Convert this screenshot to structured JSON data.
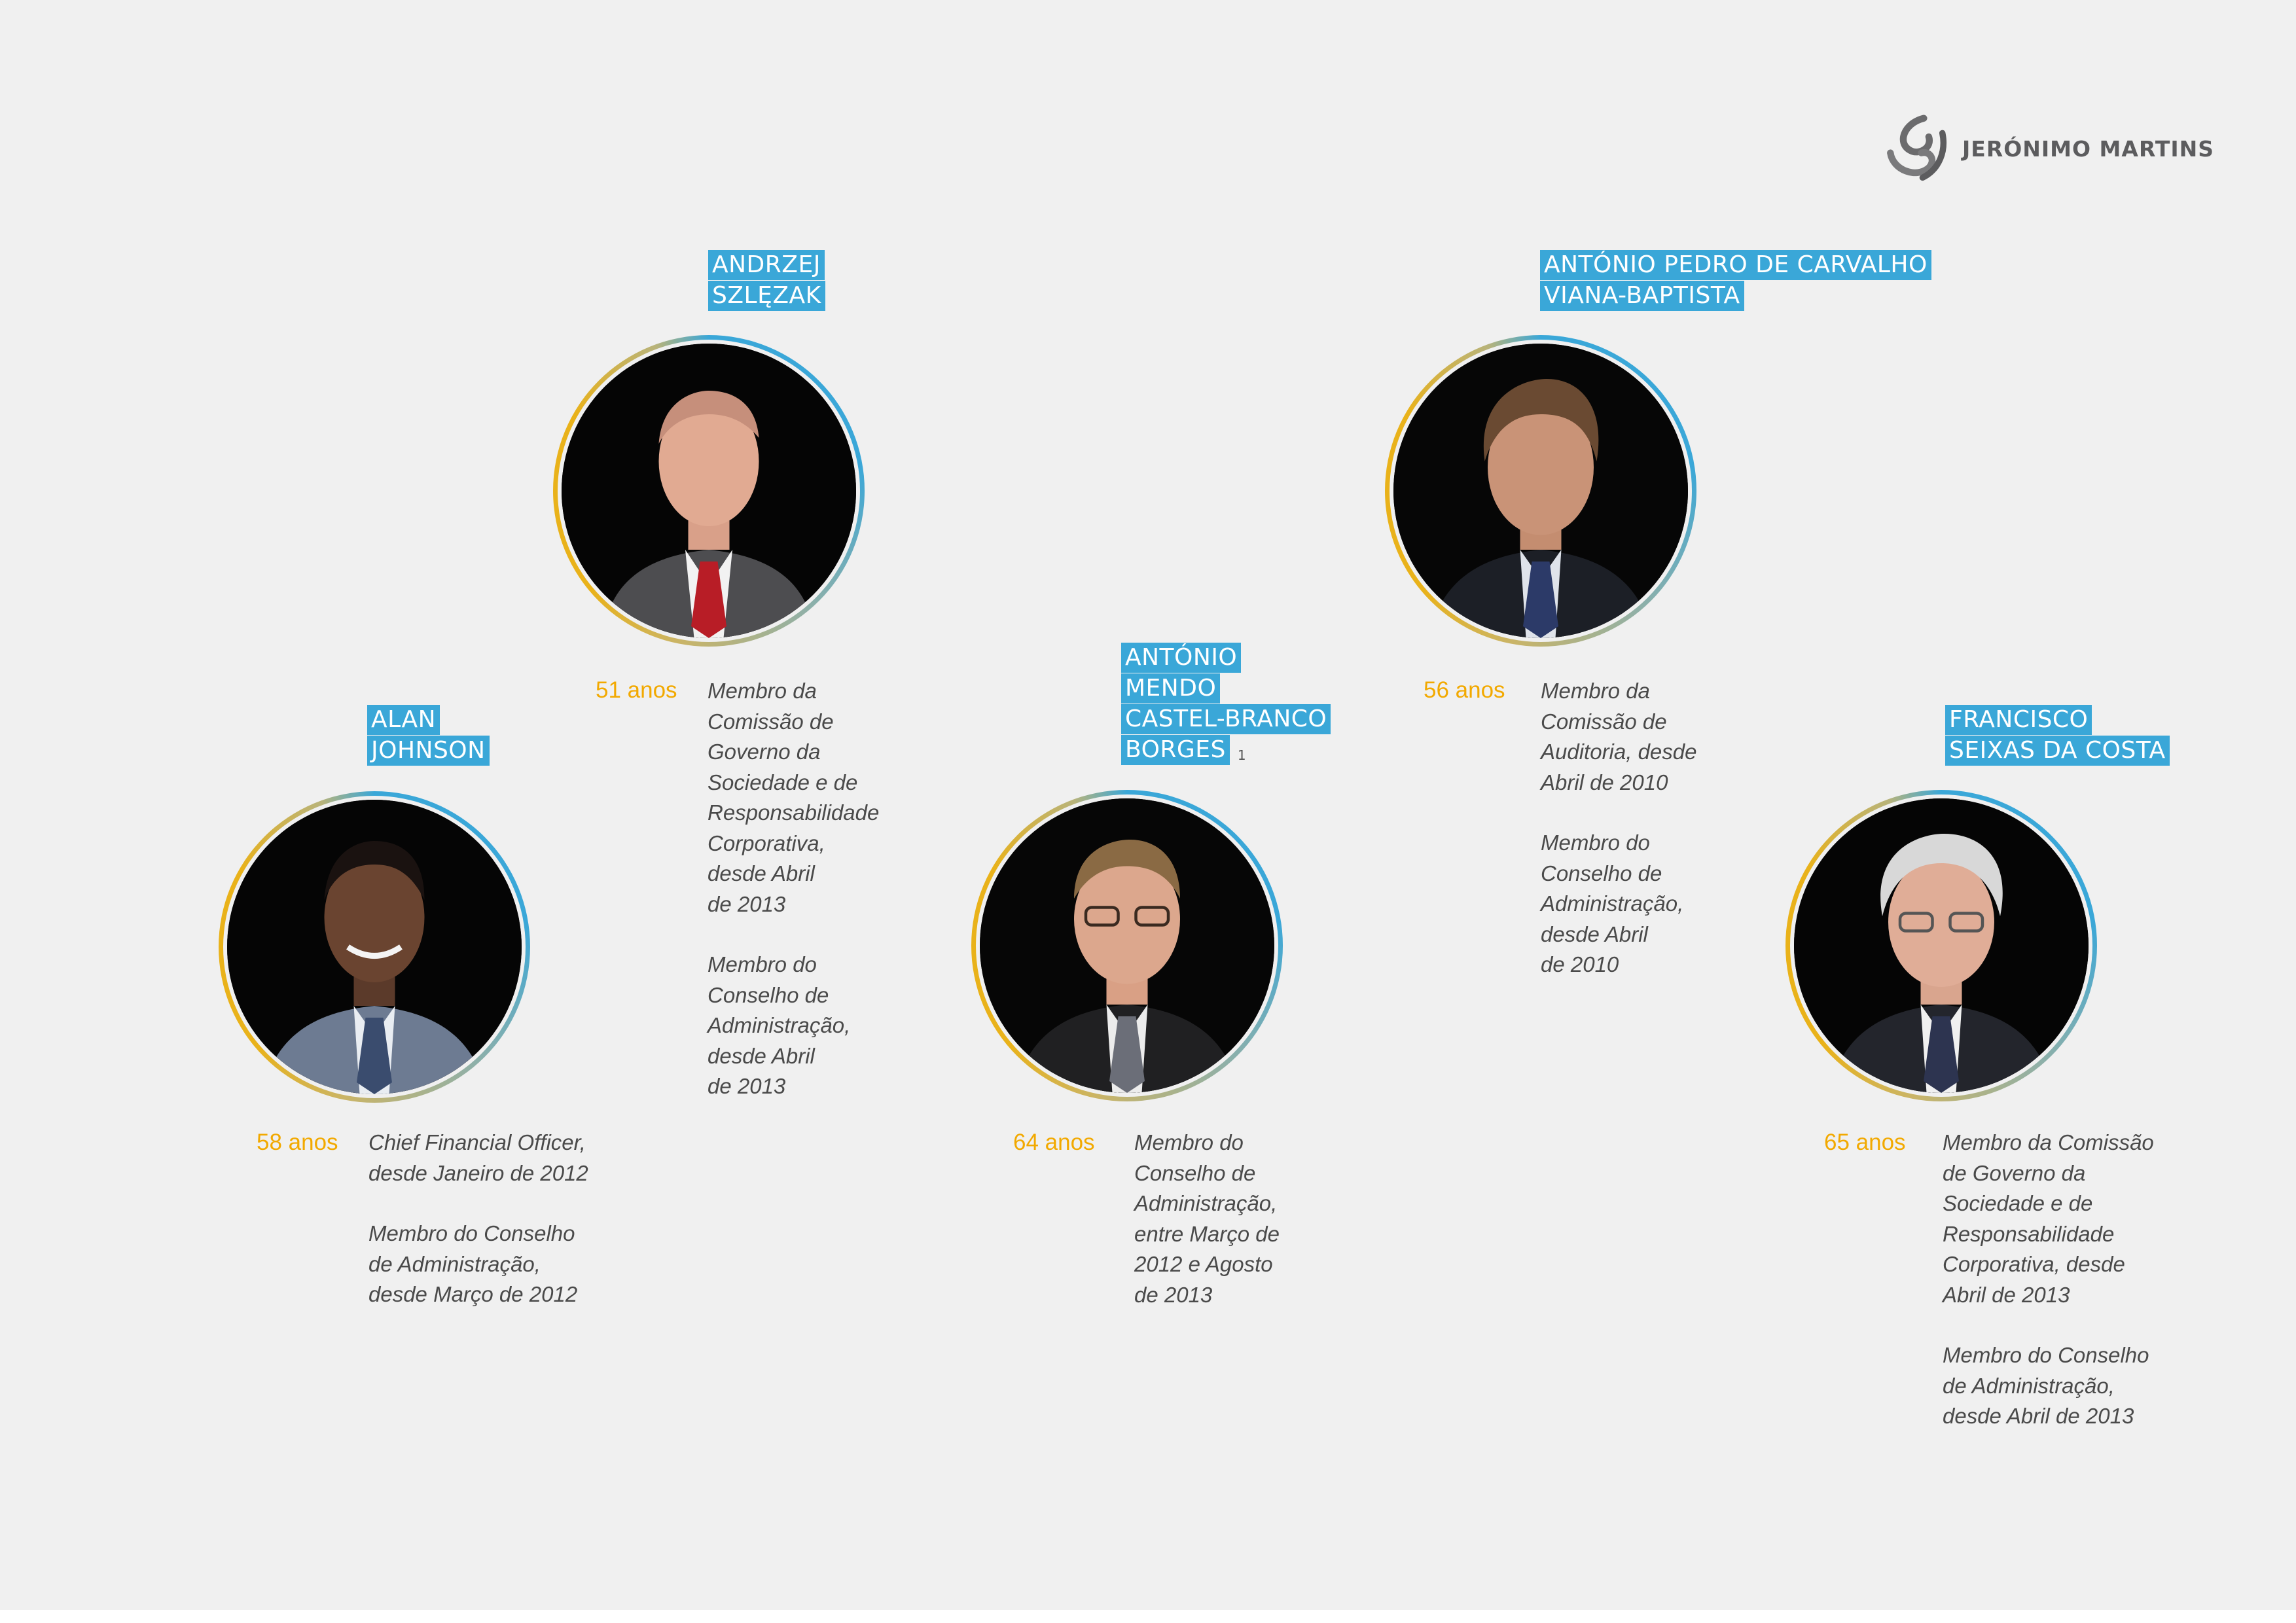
{
  "brand": {
    "name": "JERÓNIMO MARTINS",
    "logo_icon": "jeronimo-martins-logo-icon"
  },
  "colors": {
    "accent_blue": "#3aa7d8",
    "age_orange": "#f2a900",
    "text": "#4a4a4a",
    "background": "#f0f0f0"
  },
  "members": [
    {
      "id": "andrzej",
      "name_lines": [
        "ANDRZEJ",
        "SZLĘZAK"
      ],
      "age": "51 anos",
      "roles": [
        "Membro da\nComissão de\nGoverno da\nSociedade e de\nResponsabilidade\nCorporativa,\ndesde Abril\nde 2013",
        "Membro do\nConselho de\nAdministração,\ndesde Abril\nde 2013"
      ]
    },
    {
      "id": "antonio-viana",
      "name_lines": [
        "ANTÓNIO PEDRO DE CARVALHO",
        "VIANA-BAPTISTA"
      ],
      "age": "56 anos",
      "roles": [
        "Membro da\nComissão de\nAuditoria, desde\nAbril de 2010",
        "Membro do\nConselho de\nAdministração,\ndesde Abril\nde 2010"
      ]
    },
    {
      "id": "alan",
      "name_lines": [
        "ALAN",
        "JOHNSON"
      ],
      "age": "58 anos",
      "roles": [
        "Chief Financial Officer,\ndesde Janeiro de 2012",
        "Membro do Conselho\nde Administração,\ndesde Março de 2012"
      ]
    },
    {
      "id": "antonio-borges",
      "name_lines": [
        "ANTÓNIO",
        "MENDO",
        "CASTEL-BRANCO",
        "BORGES"
      ],
      "footnote": "1",
      "age": "64 anos",
      "roles": [
        "Membro do\nConselho de\nAdministração,\nentre Março de\n2012 e Agosto\nde 2013"
      ]
    },
    {
      "id": "francisco",
      "name_lines": [
        "FRANCISCO",
        "SEIXAS DA COSTA"
      ],
      "age": "65 anos",
      "roles": [
        "Membro da Comissão\nde Governo da\nSociedade e de\nResponsabilidade\nCorporativa, desde\nAbril de 2013",
        "Membro do Conselho\nde Administração,\ndesde Abril de 2013"
      ]
    }
  ]
}
